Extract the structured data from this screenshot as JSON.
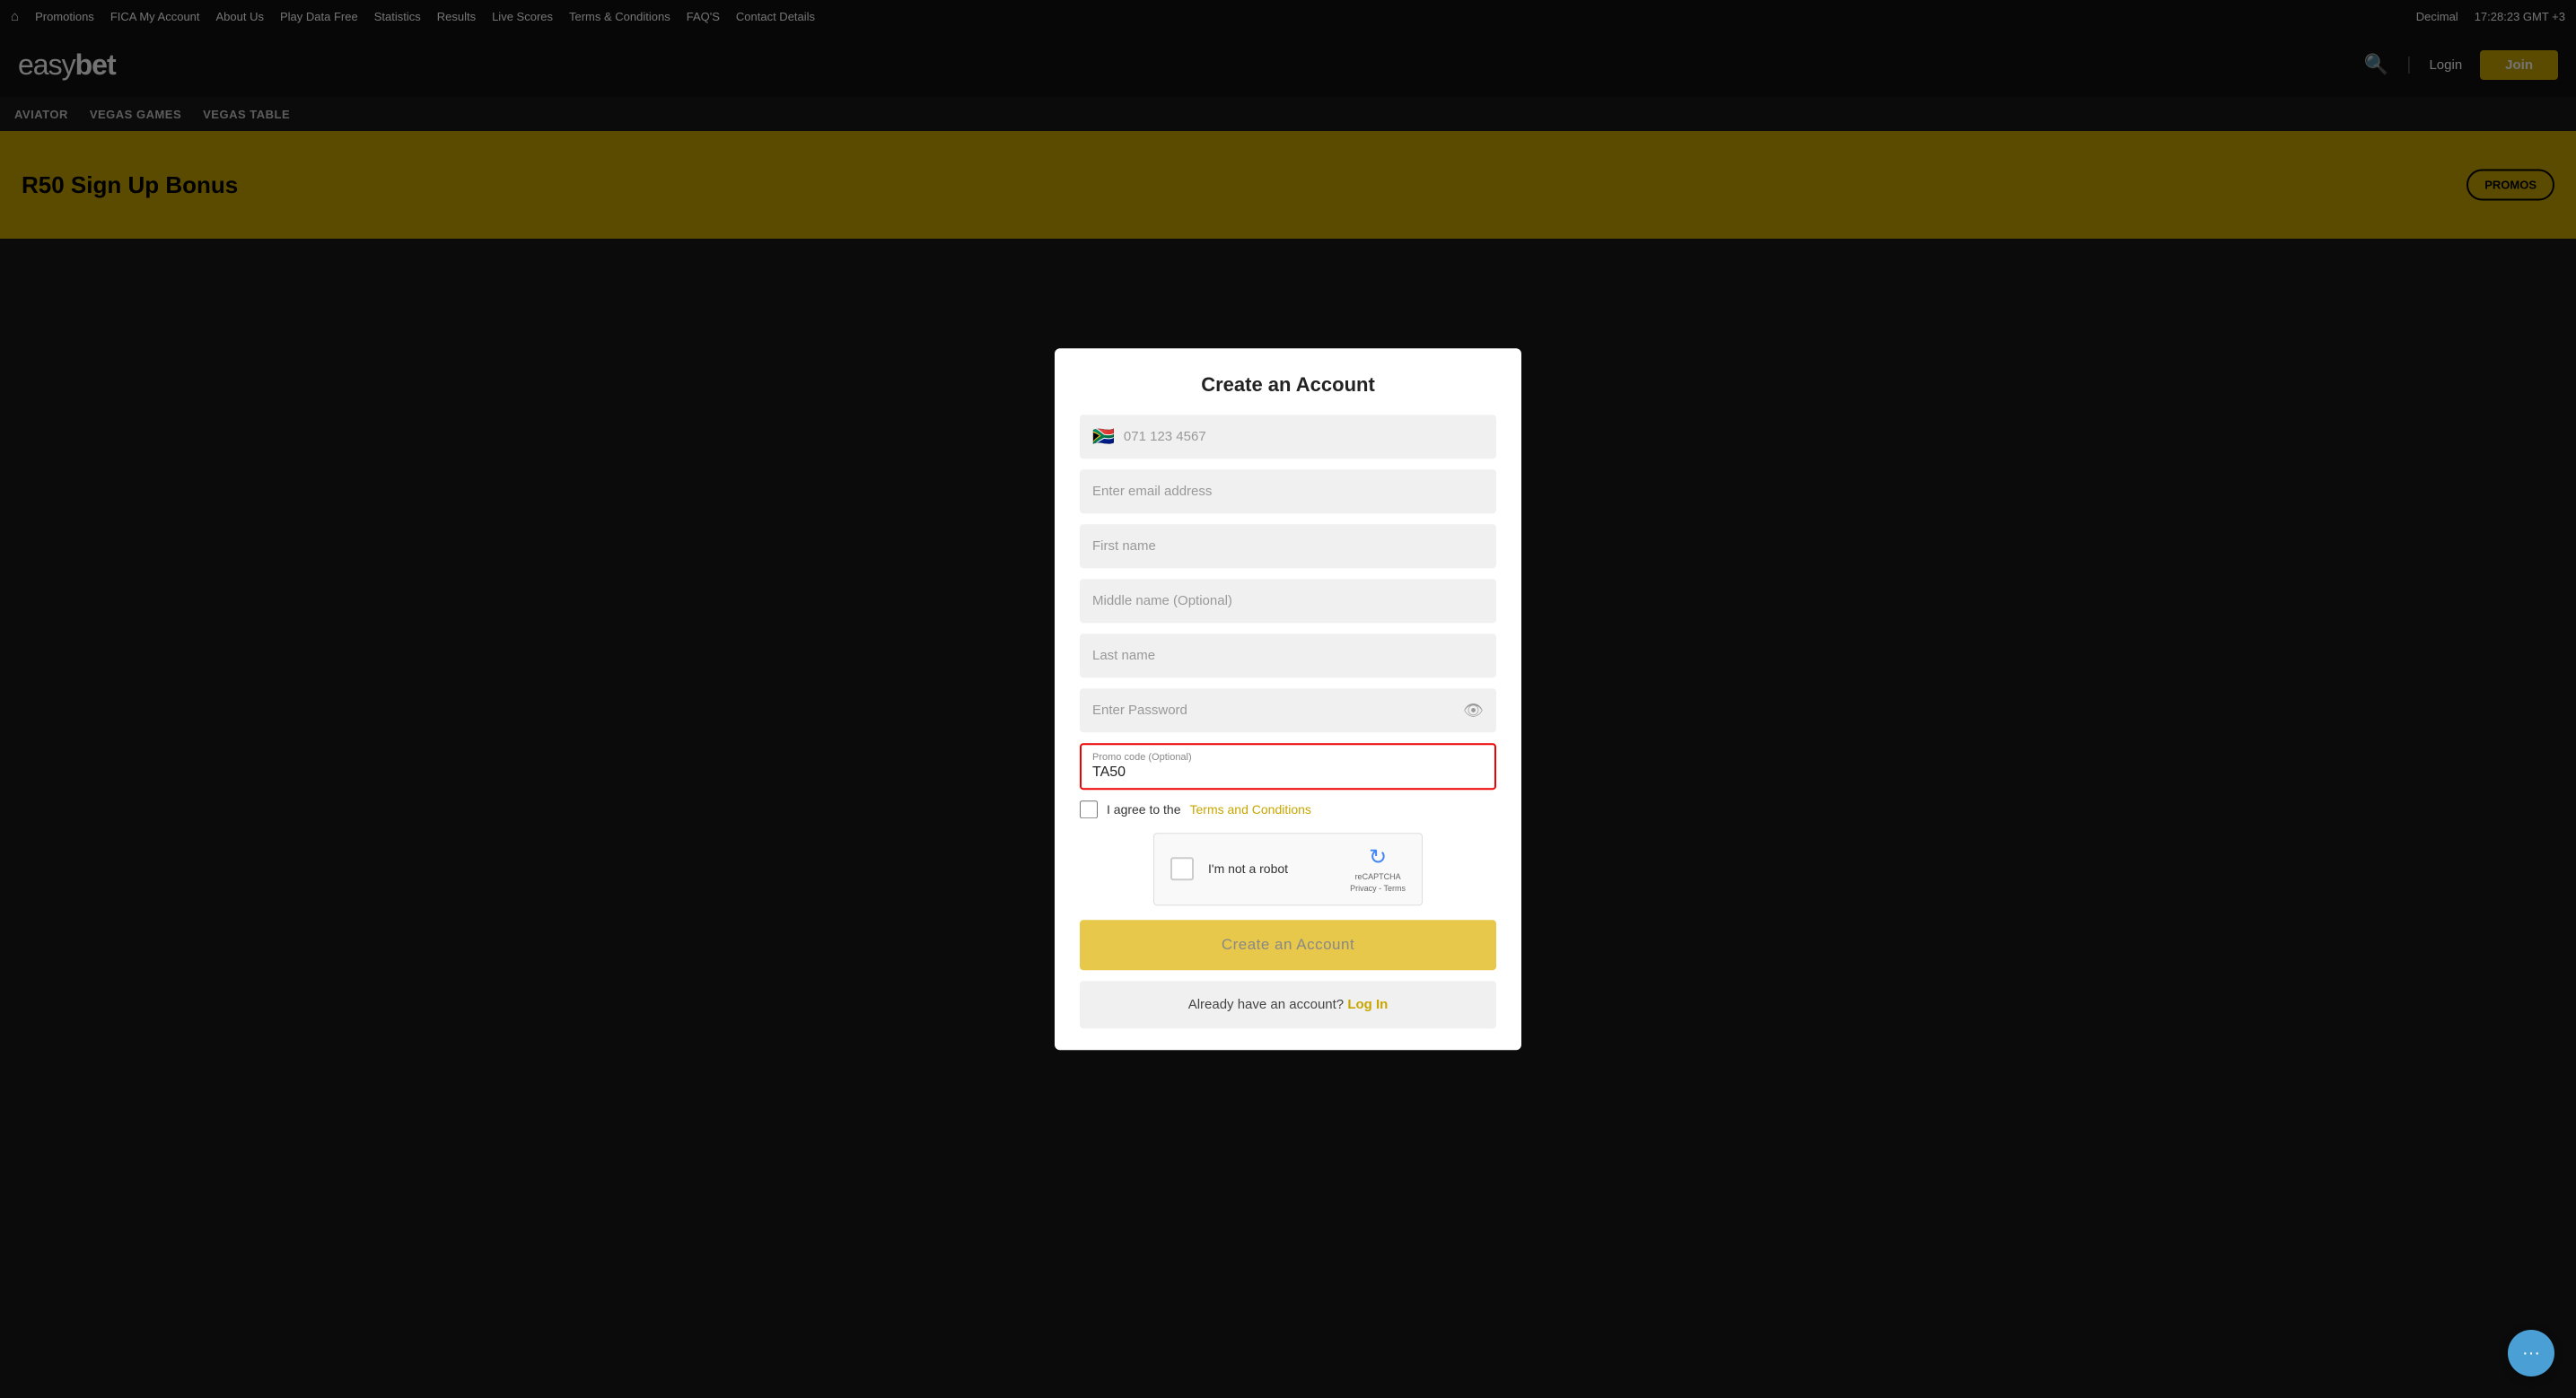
{
  "topnav": {
    "home_icon": "⌂",
    "items": [
      "Promotions",
      "FICA My Account",
      "About Us",
      "Play Data Free",
      "Statistics",
      "Results",
      "Live Scores",
      "Terms & Conditions",
      "FAQ'S",
      "Contact Details"
    ],
    "decimal_label": "Decimal",
    "time_label": "17:28:23 GMT +3"
  },
  "header": {
    "logo_easy": "easy",
    "logo_bet": "bet",
    "login_label": "Login",
    "join_label": "Join"
  },
  "secondary_nav": {
    "items": [
      "AVIATOR",
      "VEGAS GAMES",
      "VEGAS TABLE"
    ]
  },
  "banner": {
    "text": "R50 Sign Up Bonus",
    "promo_button": "PROMOS"
  },
  "modal": {
    "title": "Create an Account",
    "phone_flag": "🇿🇦",
    "phone_placeholder": "071 123 4567",
    "email_placeholder": "Enter email address",
    "firstname_placeholder": "First name",
    "middlename_placeholder": "Middle name (Optional)",
    "lastname_placeholder": "Last name",
    "password_placeholder": "Enter Password",
    "promo_label": "Promo code (Optional)",
    "promo_value": "TA50",
    "terms_text": "I agree to the ",
    "terms_link": "Terms and Conditions",
    "recaptcha_label": "I'm not a robot",
    "recaptcha_brand": "reCAPTCHA",
    "recaptcha_sub": "Privacy - Terms",
    "create_button": "Create an Account",
    "already_text": "Already have an account?",
    "login_link": "Log In"
  }
}
